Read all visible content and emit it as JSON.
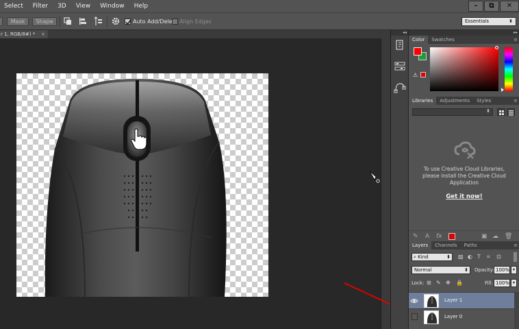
{
  "menu": {
    "items": [
      "Select",
      "Filter",
      "3D",
      "View",
      "Window",
      "Help"
    ],
    "minimize": "–",
    "restore": "⧉",
    "close": "✕"
  },
  "options": {
    "mask_label": "Mask",
    "shape_label": "Shape",
    "auto_add_delete": "Auto Add/Delete",
    "align_edges": "Align Edges",
    "workspace": "Essentials",
    "auto_add_checked": true,
    "align_edges_checked": false
  },
  "document": {
    "tab_title": "r 1, RGB/8#) *",
    "tab_close": "×"
  },
  "color_panel": {
    "tabs": [
      "Color",
      "Swatches"
    ],
    "foreground": "#ff0000",
    "background": "#1d9a3a"
  },
  "libraries_panel": {
    "tabs": [
      "Libraries",
      "Adjustments",
      "Styles"
    ],
    "message": "To use Creative Cloud Libraries, please install the Creative Cloud Application",
    "link": "Get it now!"
  },
  "layers_panel": {
    "tabs": [
      "Layers",
      "Channels",
      "Paths"
    ],
    "filter_kind": "Kind",
    "blend_mode": "Normal",
    "opacity_label": "Opacity:",
    "opacity_value": "100%",
    "lock_label": "Lock:",
    "fill_label": "Fill:",
    "fill_value": "100%",
    "layers": [
      {
        "name": "Layer 1",
        "visible": true,
        "selected": true
      },
      {
        "name": "Layer 0",
        "visible": false,
        "selected": false
      }
    ]
  },
  "colors": {
    "annotation": "#e00000",
    "selection": "#6f7f9b"
  }
}
